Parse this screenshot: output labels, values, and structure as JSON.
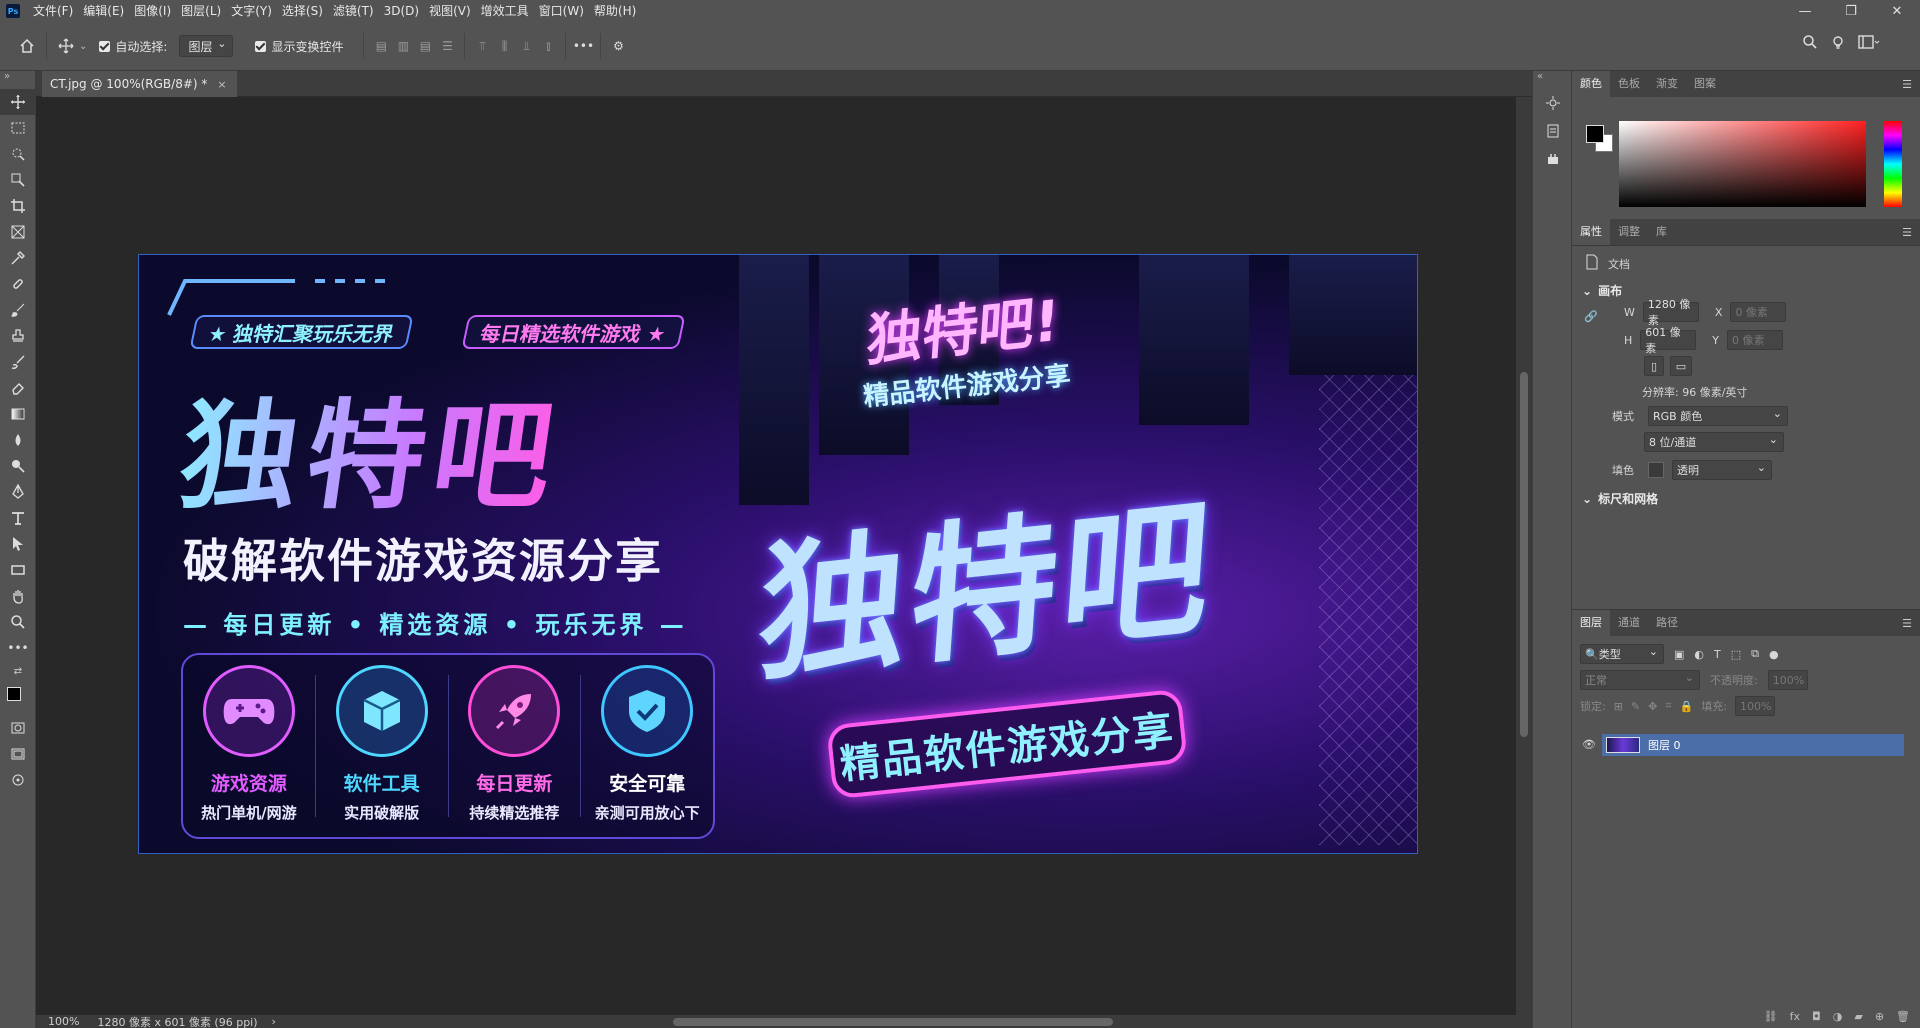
{
  "app": {
    "logo_text": "Ps",
    "menu": [
      "文件(F)",
      "编辑(E)",
      "图像(I)",
      "图层(L)",
      "文字(Y)",
      "选择(S)",
      "滤镜(T)",
      "3D(D)",
      "视图(V)",
      "增效工具",
      "窗口(W)",
      "帮助(H)"
    ],
    "window_controls": [
      "—",
      "❐",
      "✕"
    ]
  },
  "options_bar": {
    "auto_select_label": "自动选择:",
    "auto_select_value": "图层",
    "show_transform_label": "显示变换控件",
    "more_label": "•••"
  },
  "document": {
    "tab_title": "CT.jpg @ 100%(RGB/8#) *",
    "close_glyph": "×"
  },
  "status": {
    "zoom": "100%",
    "doc_info": "1280 像素 x 601 像素 (96 ppi)",
    "arrow": "›"
  },
  "banner": {
    "pill_left": "★ 独特汇聚玩乐无界",
    "pill_right": "每日精选软件游戏 ★",
    "big_title": "独特吧",
    "sub_title": "破解软件游戏资源分享",
    "tagline": "— 每日更新 • 精选资源 • 玩乐无界 —",
    "sign_top_title": "独特吧!",
    "sign_top_sub": "精品软件游戏分享",
    "sign_big": "独特吧",
    "sign_bottom": "精品软件游戏分享",
    "features": [
      {
        "title": "游戏资源",
        "sub": "热门单机/网游",
        "color": "#e05cff",
        "icon": "gamepad-icon"
      },
      {
        "title": "软件工具",
        "sub": "实用破解版",
        "color": "#4fd8ff",
        "icon": "box-icon"
      },
      {
        "title": "每日更新",
        "sub": "持续精选推荐",
        "color": "#ff4fd8",
        "icon": "rocket-icon"
      },
      {
        "title": "安全可靠",
        "sub": "亲测可用放心下",
        "color": "#3ec8ff",
        "icon": "shield-icon"
      }
    ]
  },
  "color_panel": {
    "tabs": [
      "颜色",
      "色板",
      "渐变",
      "图案"
    ],
    "active_tab": 0
  },
  "properties_panel": {
    "tabs": [
      "属性",
      "调整",
      "库"
    ],
    "doc_label": "文档",
    "canvas_section": "画布",
    "w_label": "W",
    "w_value": "1280 像素",
    "h_label": "H",
    "h_value": "601 像素",
    "x_label": "X",
    "x_placeholder": "0 像素",
    "y_label": "Y",
    "y_placeholder": "0 像素",
    "resolution": "分辨率: 96 像素/英寸",
    "mode_label": "模式",
    "mode_value": "RGB 颜色",
    "depth_value": "8 位/通道",
    "fill_label": "填色",
    "fill_value": "透明",
    "rulers_section": "标尺和网格"
  },
  "layers_panel": {
    "tabs": [
      "图层",
      "通道",
      "路径"
    ],
    "filter_kind": "类型",
    "blend_mode": "正常",
    "opacity_label": "不透明度:",
    "opacity_value": "100%",
    "lock_label": "锁定:",
    "fill_label": "填充:",
    "fill_value": "100%",
    "layer_name": "图层 0"
  }
}
